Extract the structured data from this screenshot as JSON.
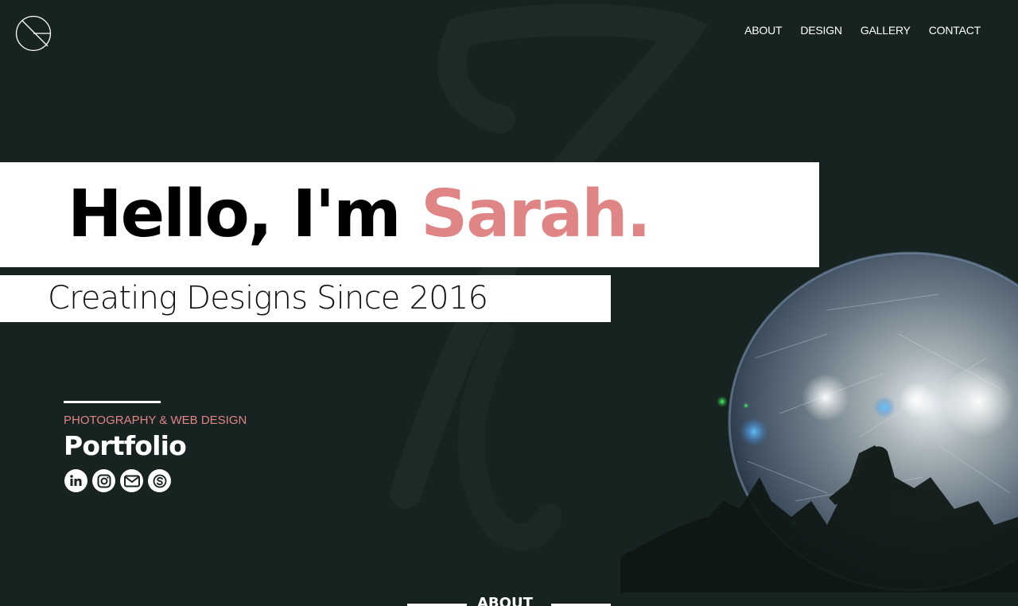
{
  "nav": {
    "items": [
      {
        "label": "ABOUT"
      },
      {
        "label": "DESIGN"
      },
      {
        "label": "GALLERY"
      },
      {
        "label": "CONTACT"
      }
    ]
  },
  "hero": {
    "greeting": "Hello, I'm ",
    "name": "Sarah.",
    "tagline": "Creating Designs Since 2016"
  },
  "intro": {
    "kicker": "PHOTOGRAPHY & WEB DESIGN",
    "title": "Portfolio",
    "socials": [
      {
        "icon": "linkedin-icon"
      },
      {
        "icon": "instagram-icon"
      },
      {
        "icon": "mail-icon"
      },
      {
        "icon": "skype-icon"
      }
    ]
  },
  "about": {
    "title": "ABOUT"
  },
  "colors": {
    "background": "#172320",
    "accent": "#e08585",
    "band": "#ffffff"
  }
}
